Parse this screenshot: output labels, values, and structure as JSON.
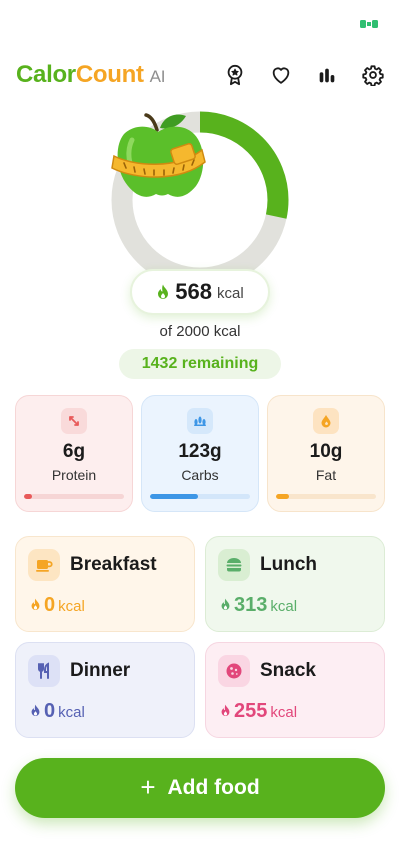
{
  "app": {
    "name_part1": "Calor",
    "name_part2": "Count",
    "name_part3": "AI"
  },
  "header_icons": [
    "award-icon",
    "heart-icon",
    "bar-chart-icon",
    "gear-icon"
  ],
  "summary": {
    "consumed": "568",
    "consumed_unit": "kcal",
    "goal_text": "of 2000 kcal",
    "remaining_text": "1432 remaining",
    "progress_fraction": 0.284
  },
  "macros": [
    {
      "value": "6g",
      "label": "Protein",
      "progress": 0.08,
      "icon": "arrows-diagonal-icon"
    },
    {
      "value": "123g",
      "label": "Carbs",
      "progress": 0.48,
      "icon": "grains-icon"
    },
    {
      "value": "10g",
      "label": "Fat",
      "progress": 0.13,
      "icon": "droplet-icon"
    }
  ],
  "meals": {
    "breakfast": {
      "name": "Breakfast",
      "kcal": "0",
      "unit": "kcal",
      "icon": "coffee-cup-icon"
    },
    "lunch": {
      "name": "Lunch",
      "kcal": "313",
      "unit": "kcal",
      "icon": "burger-icon"
    },
    "dinner": {
      "name": "Dinner",
      "kcal": "0",
      "unit": "kcal",
      "icon": "utensils-icon"
    },
    "snack": {
      "name": "Snack",
      "kcal": "255",
      "unit": "kcal",
      "icon": "cookie-icon"
    }
  },
  "add_button": {
    "plus": "+",
    "label": "Add food"
  },
  "colors": {
    "brand_green": "#58b21d",
    "brand_orange": "#f5a524",
    "ring_track": "#e1e1dc"
  }
}
